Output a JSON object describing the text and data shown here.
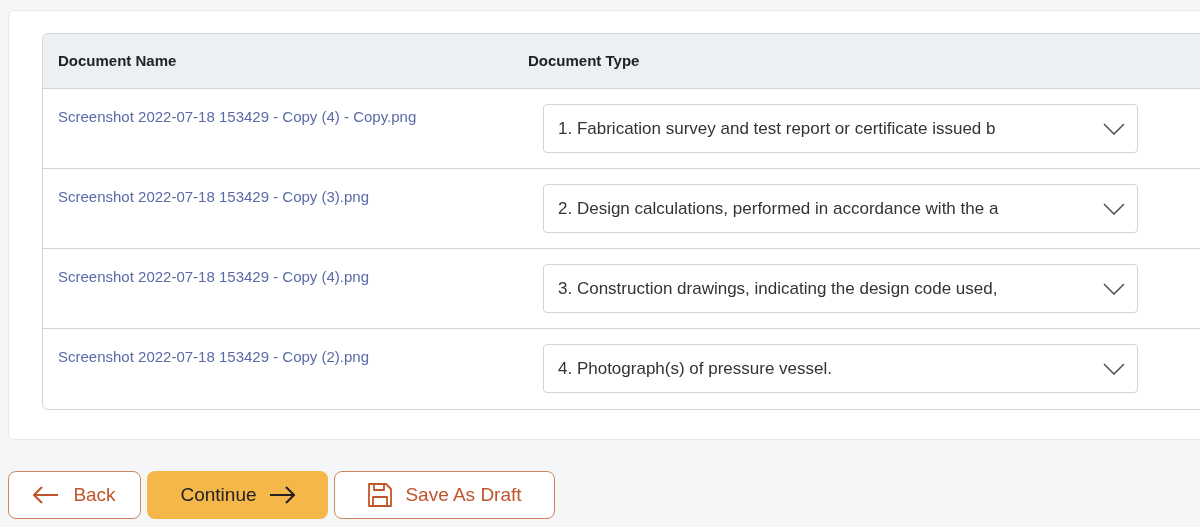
{
  "table": {
    "columns": [
      "Document Name",
      "Document Type"
    ],
    "rows": [
      {
        "name": "Screenshot 2022-07-18 153429 - Copy (4) - Copy.png",
        "type": "1. Fabrication survey and test report or certificate issued b"
      },
      {
        "name": "Screenshot 2022-07-18 153429 - Copy (3).png",
        "type": "2. Design calculations, performed in accordance with the a"
      },
      {
        "name": "Screenshot 2022-07-18 153429 - Copy (4).png",
        "type": "3. Construction drawings, indicating the design code used,"
      },
      {
        "name": "Screenshot 2022-07-18 153429 - Copy (2).png",
        "type": "4. Photograph(s) of pressure vessel."
      }
    ]
  },
  "buttons": [
    {
      "kind": "back",
      "label": "Back"
    },
    {
      "kind": "continue",
      "label": "Continue"
    },
    {
      "kind": "draft",
      "label": "Save As Draft"
    }
  ]
}
